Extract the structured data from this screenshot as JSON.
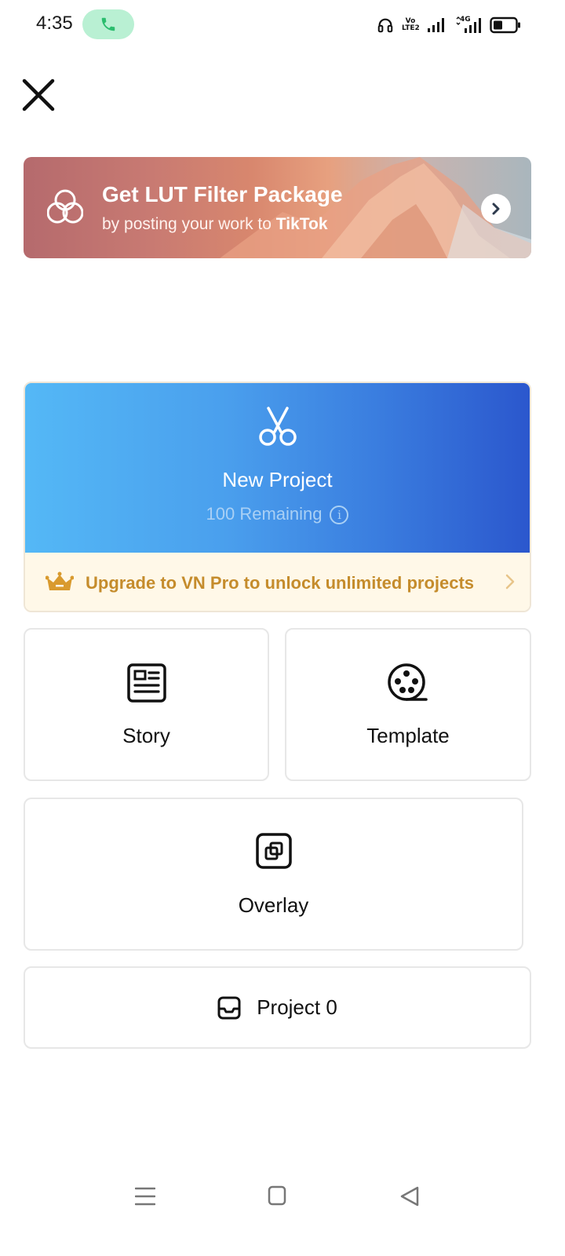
{
  "status_bar": {
    "time": "4:35",
    "network_volte": "Vo LTE2",
    "network_4g": "4G"
  },
  "banner": {
    "title": "Get LUT Filter Package",
    "subtitle_prefix": "by posting your work to",
    "subtitle_brand": "TikTok"
  },
  "new_project": {
    "title": "New Project",
    "remaining": "100 Remaining",
    "upgrade_text": "Upgrade to VN Pro to unlock unlimited projects"
  },
  "tiles": {
    "story": "Story",
    "template": "Template",
    "overlay": "Overlay"
  },
  "projects": {
    "label": "Project 0"
  },
  "colors": {
    "accent_blue": "#2b57cd",
    "accent_light_blue": "#54b8f6",
    "upgrade_gold": "#c58c2c",
    "call_green": "#b9f0d3"
  },
  "icons": {
    "close": "close-icon",
    "call": "phone-icon",
    "scissors": "scissors-icon",
    "crown": "crown-icon",
    "story": "story-icon",
    "template": "film-reel-icon",
    "overlay": "overlay-icon",
    "projects": "inbox-icon"
  }
}
